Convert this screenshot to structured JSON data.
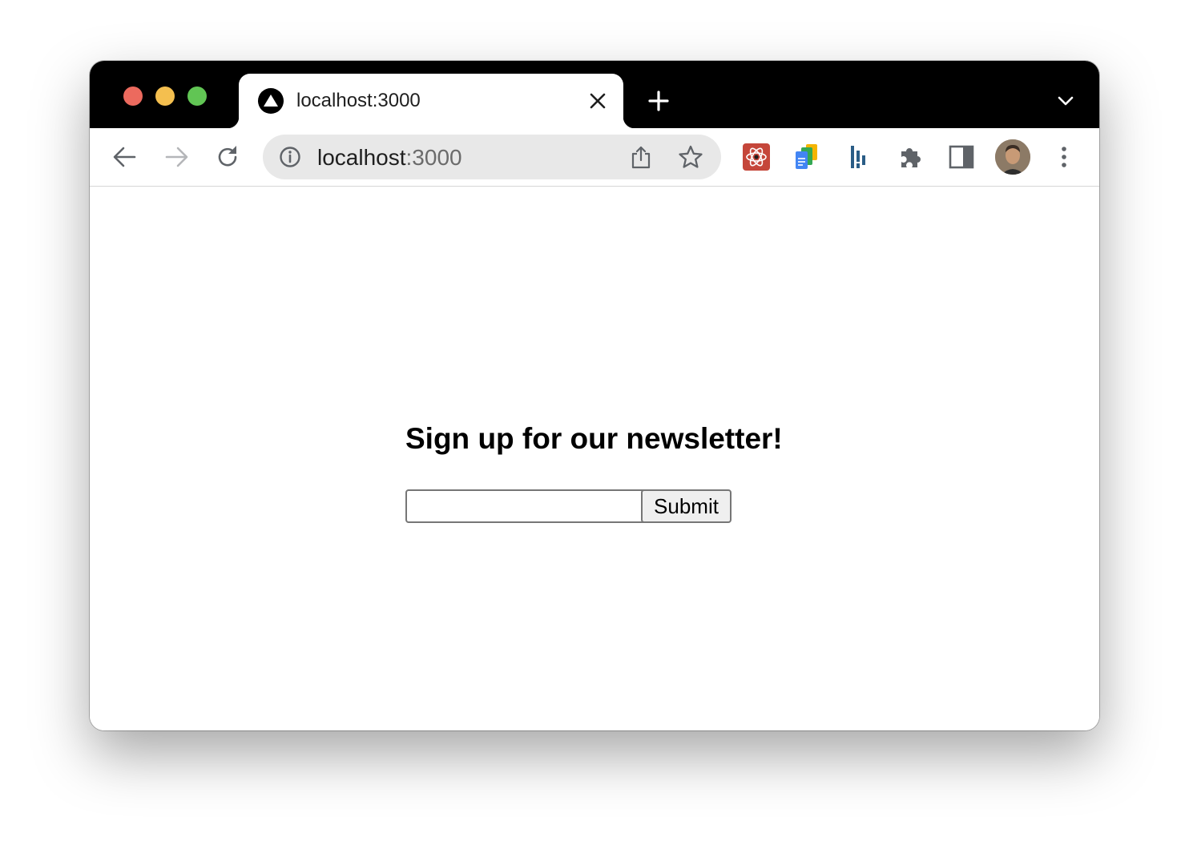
{
  "window": {
    "traffic_lights": {
      "close_color": "#ec6a5e",
      "minimize_color": "#f4bf4f",
      "maximize_color": "#61c554"
    }
  },
  "tab": {
    "title": "localhost:3000",
    "favicon": "triangle-logo-icon",
    "close_icon": "close-icon"
  },
  "tabstrip": {
    "new_tab_icon": "plus-icon",
    "tab_search_icon": "chevron-down-icon"
  },
  "toolbar": {
    "back_icon": "arrow-left-icon",
    "forward_icon": "arrow-right-icon",
    "reload_icon": "reload-icon",
    "extensions": [
      "react-devtools-icon",
      "google-docs-icon",
      "extension-bars-icon",
      "puzzle-icon"
    ],
    "side_panel_icon": "side-panel-icon",
    "profile_icon": "avatar",
    "menu_icon": "more-vertical-icon"
  },
  "omnibox": {
    "info_icon": "info-icon",
    "host": "localhost",
    "port": ":3000",
    "share_icon": "share-icon",
    "bookmark_icon": "star-icon"
  },
  "page": {
    "heading": "Sign up for our newsletter!",
    "email_value": "",
    "submit_label": "Submit"
  }
}
